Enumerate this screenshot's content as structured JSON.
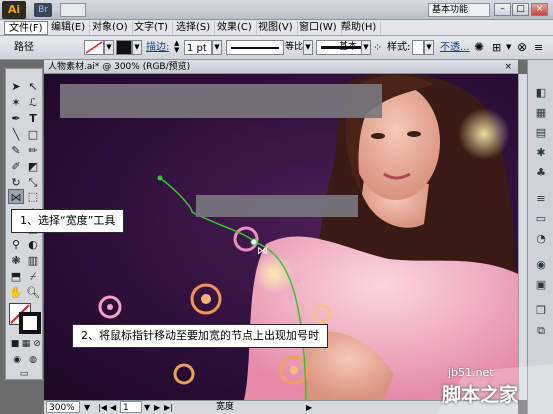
{
  "app": {
    "logo": "Ai",
    "bridge": "Br",
    "workspace": "基本功能",
    "win_min": "–",
    "win_max": "□",
    "win_close": "×"
  },
  "menu": [
    "文件(F)",
    "编辑(E)",
    "对象(O)",
    "文字(T)",
    "选择(S)",
    "效果(C)",
    "视图(V)",
    "窗口(W)",
    "帮助(H)"
  ],
  "controlbar": {
    "selection_label": "路径",
    "stroke_label": "描边:",
    "stroke_value": "1 pt",
    "profile_label": "等比",
    "brush_label": "基本",
    "style_label": "样式:",
    "opacity_label": "不透..."
  },
  "document": {
    "tab_title": "人物素材.ai* @ 300% (RGB/预览)",
    "close": "×"
  },
  "statusbar": {
    "zoom": "300%",
    "page": "1",
    "tool_name": "宽度"
  },
  "annotations": {
    "step1": "1、选择“宽度”工具",
    "step2": "2、将鼠标指针移动至要加宽的节点上出现加号时"
  },
  "watermark": {
    "url": "jb51.net",
    "text": "脚本之家"
  },
  "colors": {
    "path_stroke": "#32c832",
    "canvas_bg": "#2e0f3a"
  }
}
